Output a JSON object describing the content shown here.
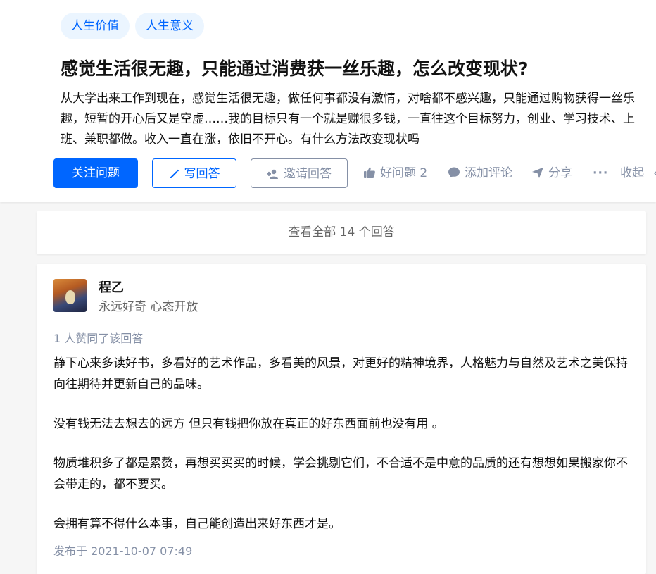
{
  "topics": [
    "人生价值",
    "人生意义"
  ],
  "question": {
    "title": "感觉生活很无趣，只能通过消费获一丝乐趣，怎么改变现状?",
    "detail": "从大学出来工作到现在，感觉生活很无趣，做任何事都没有激情，对啥都不感兴趣，只能通过购物获得一丝乐趣，短暂的开心后又是空虚……我的目标只有一个就是赚很多钱，一直往这个目标努力，创业、学习技术、上班、兼职都做。收入一直在涨，依旧不开心。有什么方法改变现状吗"
  },
  "actions": {
    "follow": "关注问题",
    "write": "写回答",
    "invite": "邀请回答",
    "good_question": "好问题 2",
    "add_comment": "添加评论",
    "share": "分享",
    "more": "···",
    "collapse": "收起",
    "colors": {
      "accent": "#0066ff",
      "muted": "#8590a6",
      "tag_bg": "#ebf5ff"
    }
  },
  "view_all": "查看全部 14 个回答",
  "answer": {
    "author_name": "程乙",
    "author_bio": "永远好奇 心态开放",
    "votes": "1 人赞同了该回答",
    "paragraphs": [
      "静下心来多读好书，多看好的艺术作品，多看美的风景，对更好的精神境界，人格魅力与自然及艺术之美保持向往期待并更新自己的品味。",
      "没有钱无法去想去的远方 但只有钱把你放在真正的好东西面前也没有用 。",
      "物质堆积多了都是累赘，再想买买买的时候，学会挑剔它们，不合适不是中意的品质的还有想想如果搬家你不会带走的，都不要买。",
      "会拥有算不得什么本事，自己能创造出来好东西才是。"
    ],
    "published": "发布于 2021-10-07 07:49"
  }
}
